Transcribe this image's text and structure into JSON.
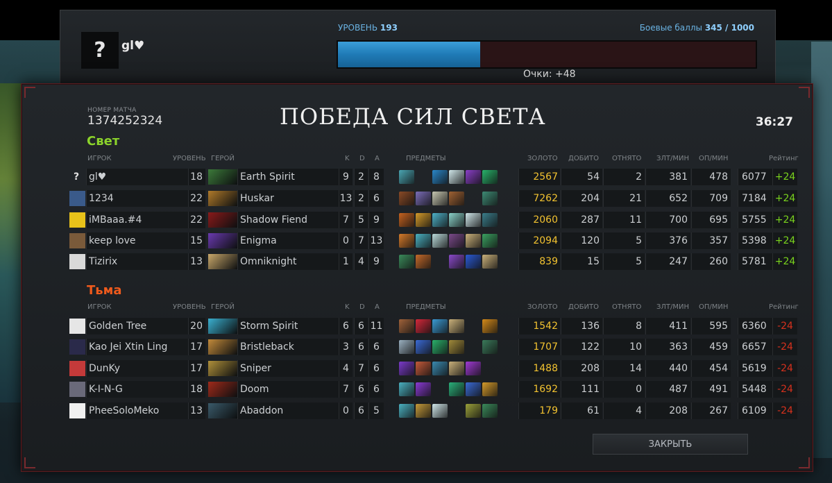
{
  "level_panel": {
    "avatar_char": "?",
    "player_name": "gl♥",
    "level_prefix": "УРОВЕНЬ",
    "level_value": "193",
    "battle_prefix": "Боевые баллы",
    "battle_value": "345 / 1000",
    "xp_progress": 0.34,
    "points": "Очки: +48"
  },
  "match": {
    "id_label": "НОМЕР МАТЧА",
    "id": "1374252324",
    "result_title": "ПОБЕДА СИЛ СВЕТА",
    "duration": "36:27",
    "close_label": "ЗАКРЫТЬ"
  },
  "headers": {
    "player": "ИГРОК",
    "level": "УРОВЕНЬ",
    "hero": "ГЕРОЙ",
    "k": "K",
    "d": "D",
    "a": "A",
    "items": "ПРЕДМЕТЫ",
    "gold": "ЗОЛОТО",
    "last_hits": "ДОБИТО",
    "denies": "ОТНЯТО",
    "gpm": "ЗЛТ/МИН",
    "xpm": "ОП/МИН",
    "rating": "Рейтинг"
  },
  "teams": [
    {
      "name": "Свет",
      "color": "#8bd32b",
      "players": [
        {
          "name": "gl♥",
          "level": "18",
          "hero": "Earth Spirit",
          "k": "9",
          "d": "2",
          "a": "8",
          "gold": "2567",
          "last_hits": "54",
          "denies": "2",
          "gpm": "381",
          "xpm": "478",
          "rating": "6077",
          "delta": "+24",
          "avatar_color": "#111214",
          "hero_color": "#3c7a3a",
          "items": [
            "#4aa6b3",
            "",
            "#2a87c9",
            "#cfe6e9",
            "#8a3fc7",
            "#28b26a"
          ]
        },
        {
          "name": "1234",
          "level": "22",
          "hero": "Huskar",
          "k": "13",
          "d": "2",
          "a": "6",
          "gold": "7262",
          "last_hits": "204",
          "denies": "21",
          "gpm": "652",
          "xpm": "709",
          "rating": "7184",
          "delta": "+24",
          "avatar_color": "#3a5a8a",
          "hero_color": "#b07a2a",
          "items": [
            "#8a4a26",
            "#7b6db8",
            "#c6c6b0",
            "#a06233",
            "",
            "#3d8a74"
          ]
        },
        {
          "name": "iMBaaa.#4",
          "level": "22",
          "hero": "Shadow Fiend",
          "k": "7",
          "d": "5",
          "a": "9",
          "gold": "2060",
          "last_hits": "287",
          "denies": "11",
          "gpm": "700",
          "xpm": "695",
          "rating": "5755",
          "delta": "+24",
          "avatar_color": "#e8c21a",
          "hero_color": "#8a1a1a",
          "items": [
            "#c4621f",
            "#d49a2a",
            "#4db0c6",
            "#8ad1c9",
            "#cfe6e9",
            "#3a7d8a"
          ]
        },
        {
          "name": "keep love",
          "level": "15",
          "hero": "Enigma",
          "k": "0",
          "d": "7",
          "a": "13",
          "gold": "2094",
          "last_hits": "120",
          "denies": "5",
          "gpm": "376",
          "xpm": "357",
          "rating": "5398",
          "delta": "+24",
          "avatar_color": "#7a5a3a",
          "hero_color": "#6a3ab0",
          "items": [
            "#d47a2a",
            "#4ab0c0",
            "#b9d9d9",
            "#7a4a8a",
            "#c9b07a",
            "#3aa060"
          ]
        },
        {
          "name": "Tizirix",
          "level": "13",
          "hero": "Omniknight",
          "k": "1",
          "d": "4",
          "a": "9",
          "gold": "839",
          "last_hits": "15",
          "denies": "5",
          "gpm": "247",
          "xpm": "260",
          "rating": "5781",
          "delta": "+24",
          "avatar_color": "#d9d9d9",
          "hero_color": "#c9a86a",
          "items": [
            "#3a8a5a",
            "#c46a2a",
            "",
            "#8a4ac9",
            "#2a5ad4",
            "#c9b07a"
          ]
        }
      ]
    },
    {
      "name": "Тьма",
      "color": "#ef5a1c",
      "players": [
        {
          "name": "Golden Tree",
          "level": "20",
          "hero": "Storm Spirit",
          "k": "6",
          "d": "6",
          "a": "11",
          "gold": "1542",
          "last_hits": "136",
          "denies": "8",
          "gpm": "411",
          "xpm": "595",
          "rating": "6360",
          "delta": "-24",
          "avatar_color": "#e6e6e6",
          "hero_color": "#3ab0d0",
          "items": [
            "#a0623a",
            "#d4283a",
            "#3a9ad4",
            "#c9b07a",
            "",
            "#d48a1a"
          ]
        },
        {
          "name": "Kao Jei Xtin Ling",
          "level": "17",
          "hero": "Bristleback",
          "k": "3",
          "d": "6",
          "a": "6",
          "gold": "1707",
          "last_hits": "122",
          "denies": "10",
          "gpm": "363",
          "xpm": "459",
          "rating": "6657",
          "delta": "-24",
          "avatar_color": "#2a2a4a",
          "hero_color": "#c28a3a",
          "items": [
            "#9ab0c0",
            "#3a6ad4",
            "#2ab06a",
            "#a08a3a",
            "",
            "#3a7a5a"
          ]
        },
        {
          "name": "DunKy",
          "level": "17",
          "hero": "Sniper",
          "k": "4",
          "d": "7",
          "a": "6",
          "gold": "1488",
          "last_hits": "208",
          "denies": "14",
          "gpm": "440",
          "xpm": "454",
          "rating": "5619",
          "delta": "-24",
          "avatar_color": "#c43a3a",
          "hero_color": "#b0903a",
          "items": [
            "#7a3ac9",
            "#c45a3a",
            "#3a8ab0",
            "#c9b07a",
            "#a03ad4",
            ""
          ]
        },
        {
          "name": "K-I-N-G",
          "level": "18",
          "hero": "Doom",
          "k": "7",
          "d": "6",
          "a": "6",
          "gold": "1692",
          "last_hits": "111",
          "denies": "0",
          "gpm": "487",
          "xpm": "491",
          "rating": "5448",
          "delta": "-24",
          "avatar_color": "#6a6a7a",
          "hero_color": "#a02a1a",
          "items": [
            "#4ab0c0",
            "#8a3ad4",
            "",
            "#2ab07a",
            "#3a6ad4",
            "#d49a2a"
          ]
        },
        {
          "name": "PheeSoloMeko",
          "level": "13",
          "hero": "Abaddon",
          "k": "0",
          "d": "6",
          "a": "5",
          "gold": "179",
          "last_hits": "61",
          "denies": "4",
          "gpm": "208",
          "xpm": "267",
          "rating": "6109",
          "delta": "-24",
          "avatar_color": "#f0f0f0",
          "hero_color": "#3a5a6a",
          "items": [
            "#4ab0c0",
            "#c49a3a",
            "#cfe6e9",
            "",
            "#9aa03a",
            "#3a8a5a"
          ]
        }
      ]
    }
  ]
}
